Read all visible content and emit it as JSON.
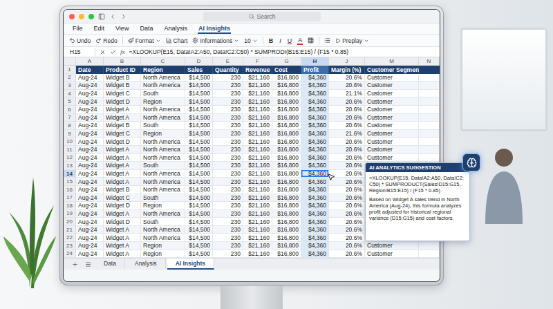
{
  "window": {
    "search_placeholder": "Search"
  },
  "menu": [
    {
      "label": "File",
      "selected": false
    },
    {
      "label": "Edit",
      "selected": false
    },
    {
      "label": "View",
      "selected": false
    },
    {
      "label": "Data",
      "selected": false
    },
    {
      "label": "Analysis",
      "selected": false
    },
    {
      "label": "AI Insights",
      "selected": true
    }
  ],
  "toolbar": {
    "undo": "Undo",
    "redo": "Redo",
    "format": "Format",
    "chart": "Chart",
    "informations": "Informations",
    "font_size": "10",
    "bold": "B",
    "italic": "I",
    "underline": "U",
    "text_color": "A",
    "preplay": "Preplay"
  },
  "formula_bar": {
    "cell": "H15",
    "fx": "fx",
    "formula": "=XLOOKUP(E15, Data!A2:A50, Data!C2:C50) * SUMPRODI(B15:E15) / (F15 * 0.85)"
  },
  "sheet": {
    "column_letters": [
      {
        "label": "A",
        "selected": false
      },
      {
        "label": "B",
        "selected": false
      },
      {
        "label": "C",
        "selected": false
      },
      {
        "label": "D",
        "selected": false
      },
      {
        "label": "E",
        "selected": false
      },
      {
        "label": "F",
        "selected": false
      },
      {
        "label": "G",
        "selected": false
      },
      {
        "label": "H",
        "selected": true
      },
      {
        "label": "J",
        "selected": false
      },
      {
        "label": "M",
        "selected": false
      },
      {
        "label": "N",
        "selected": false
      }
    ],
    "header_row": {
      "number": "1",
      "cells": [
        "Date",
        "Product ID",
        "Region",
        "Sales",
        "Quantity",
        "Revenue",
        "Cost",
        "Profit",
        "Margin (%)",
        "Customer Segment",
        ""
      ]
    },
    "rows": [
      {
        "number": "2",
        "selected": false,
        "cells": [
          "Aug-24",
          "Widget B",
          "North America",
          "$14,500",
          "230",
          "$21,160",
          "$16,800",
          "$4,360",
          "20.6%",
          "Customer",
          ""
        ]
      },
      {
        "number": "3",
        "selected": false,
        "cells": [
          "Aug-24",
          "Widget B",
          "North America",
          "$14,500",
          "230",
          "$21,160",
          "$16,800",
          "$4,360",
          "20.6%",
          "Customer",
          ""
        ]
      },
      {
        "number": "4",
        "selected": false,
        "cells": [
          "Aug-24",
          "Widget C",
          "South",
          "$14,500",
          "230",
          "$21,160",
          "$16,800",
          "$4,360",
          "21.1%",
          "Customer",
          ""
        ]
      },
      {
        "number": "5",
        "selected": false,
        "cells": [
          "Aug-24",
          "Widget D",
          "Region",
          "$14,500",
          "230",
          "$21,160",
          "$16,800",
          "$4,360",
          "20.6%",
          "Customer",
          ""
        ]
      },
      {
        "number": "6",
        "selected": false,
        "cells": [
          "Aug-24",
          "Widget A",
          "North America",
          "$14,500",
          "230",
          "$21,160",
          "$16,800",
          "$4,360",
          "20.6%",
          "Customer",
          ""
        ]
      },
      {
        "number": "7",
        "selected": false,
        "cells": [
          "Aug-24",
          "Widget A",
          "North America",
          "$14,500",
          "230",
          "$21,160",
          "$16,800",
          "$4,360",
          "20.6%",
          "Customer",
          ""
        ]
      },
      {
        "number": "8",
        "selected": false,
        "cells": [
          "Aug-24",
          "Widget B",
          "South",
          "$14,500",
          "230",
          "$21,160",
          "$16,800",
          "$4,360",
          "20.6%",
          "Customer",
          ""
        ]
      },
      {
        "number": "9",
        "selected": false,
        "cells": [
          "Aug-24",
          "Widget C",
          "Region",
          "$14,500",
          "230",
          "$21,160",
          "$16,800",
          "$4,360",
          "21.6%",
          "Customer",
          ""
        ]
      },
      {
        "number": "10",
        "selected": false,
        "cells": [
          "Aug-24",
          "Widget D",
          "North America",
          "$14,500",
          "230",
          "$21,160",
          "$16,800",
          "$4,360",
          "20.6%",
          "Customer",
          ""
        ]
      },
      {
        "number": "11",
        "selected": false,
        "cells": [
          "Aug-24",
          "Widget A",
          "North America",
          "$14,500",
          "230",
          "$21,160",
          "$16,800",
          "$4,360",
          "20.6%",
          "Customer",
          ""
        ]
      },
      {
        "number": "12",
        "selected": false,
        "cells": [
          "Aug-24",
          "Widget A",
          "North America",
          "$14,500",
          "230",
          "$21,160",
          "$16,800",
          "$4,360",
          "20.6%",
          "Customer",
          ""
        ]
      },
      {
        "number": "13",
        "selected": false,
        "cells": [
          "Aug-24",
          "Widget A",
          "South",
          "$14,500",
          "230",
          "$21,160",
          "$16,800",
          "$4,360",
          "20.6%",
          "",
          ""
        ]
      },
      {
        "number": "14",
        "selected": true,
        "cells": [
          "Aug-24",
          "Widget A",
          "North America",
          "$14,500",
          "230",
          "$21,160",
          "$16,800",
          "$4,360",
          "20.6%",
          "",
          ""
        ]
      },
      {
        "number": "15",
        "selected": false,
        "cells": [
          "Aug-24",
          "Widget A",
          "North America",
          "$14,500",
          "230",
          "$21,160",
          "$16,800",
          "$4,360",
          "20.6%",
          "",
          ""
        ]
      },
      {
        "number": "16",
        "selected": false,
        "cells": [
          "Aug-24",
          "Widget B",
          "North America",
          "$14,500",
          "230",
          "$21,160",
          "$16,800",
          "$4,360",
          "20.6%",
          "",
          ""
        ]
      },
      {
        "number": "17",
        "selected": false,
        "cells": [
          "Aug-24",
          "Widget C",
          "South",
          "$14,500",
          "230",
          "$21,160",
          "$16,800",
          "$4,360",
          "20.6%",
          "",
          ""
        ]
      },
      {
        "number": "18",
        "selected": false,
        "cells": [
          "Aug-24",
          "Widget D",
          "Region",
          "$14,500",
          "230",
          "$21,160",
          "$16,800",
          "$4,360",
          "20.6%",
          "",
          ""
        ]
      },
      {
        "number": "19",
        "selected": false,
        "cells": [
          "Aug-24",
          "Widget A",
          "North America",
          "$14,500",
          "230",
          "$21,160",
          "$16,800",
          "$4,360",
          "20.6%",
          "",
          ""
        ]
      },
      {
        "number": "20",
        "selected": false,
        "cells": [
          "Aug-24",
          "Widget D",
          "South",
          "$14,500",
          "230",
          "$21,160",
          "$16,800",
          "$4,360",
          "20.6%",
          "",
          ""
        ]
      },
      {
        "number": "21",
        "selected": false,
        "cells": [
          "Aug-24",
          "Widget A",
          "North America",
          "$14,500",
          "230",
          "$21,160",
          "$16,800",
          "$4,360",
          "20.6%",
          "",
          ""
        ]
      },
      {
        "number": "22",
        "selected": false,
        "cells": [
          "Aug-24",
          "Widget A",
          "North America",
          "$14,500",
          "230",
          "$21,160",
          "$16,800",
          "$4,360",
          "20.6%",
          "",
          ""
        ]
      },
      {
        "number": "23",
        "selected": false,
        "cells": [
          "Aug-24",
          "Widget A",
          "Region",
          "$14,500",
          "230",
          "$21,160",
          "$16,800",
          "$4,360",
          "20.6%",
          "Customer",
          ""
        ]
      },
      {
        "number": "24",
        "selected": false,
        "cells": [
          "Aug-24",
          "Widget A",
          "Region",
          "$14,500",
          "230",
          "$21,160",
          "$16,800",
          "$4,360",
          "20.6%",
          "Customer",
          ""
        ]
      }
    ]
  },
  "popup": {
    "title": "AI ANALYTICS SUGGESTION",
    "formula": "=XLOOKUP(E15, Data!A2:A50, Data!C2:C50) * SUMPRODUCT(Sales!D15:G15, Region!B15:E15) / (F15 * 0.85)",
    "description": "Based on Widget A sales trend in North America (Aug-24), this formula analyzes profit adjusted for historical regional variance (D15:G15) and cost factors."
  },
  "sheet_tabs": [
    {
      "label": "Data",
      "selected": false
    },
    {
      "label": "Analysis",
      "selected": false
    },
    {
      "label": "AI Insights",
      "selected": true
    }
  ]
}
